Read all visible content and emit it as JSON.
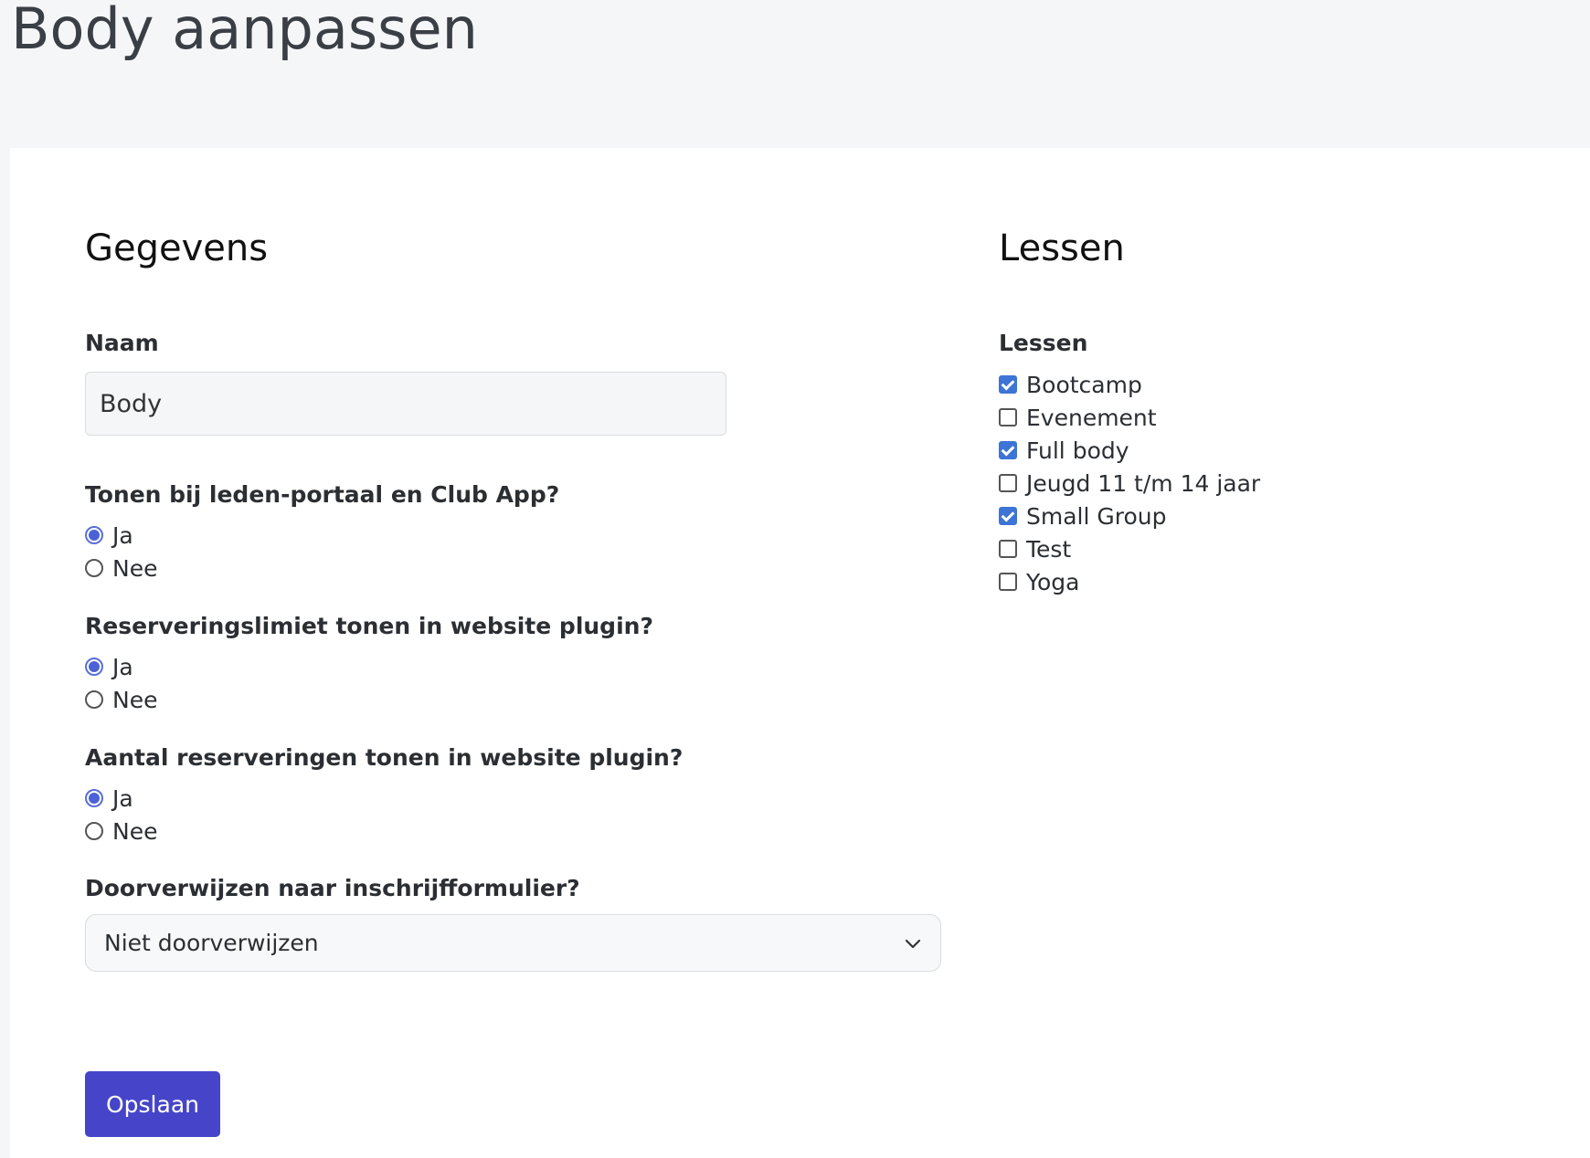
{
  "page": {
    "title": "Body aanpassen"
  },
  "details": {
    "heading": "Gegevens",
    "name_label": "Naam",
    "name_value": "Body",
    "show_portal": {
      "label": "Tonen bij leden-portaal en Club App?",
      "options": [
        "Ja",
        "Nee"
      ],
      "selected": "Ja"
    },
    "show_limit": {
      "label": "Reserveringslimiet tonen in website plugin?",
      "options": [
        "Ja",
        "Nee"
      ],
      "selected": "Ja"
    },
    "show_count": {
      "label": "Aantal reserveringen tonen in website plugin?",
      "options": [
        "Ja",
        "Nee"
      ],
      "selected": "Ja"
    },
    "redirect": {
      "label": "Doorverwijzen naar inschrijfformulier?",
      "selected": "Niet doorverwijzen"
    },
    "save_label": "Opslaan"
  },
  "lessons": {
    "heading": "Lessen",
    "label": "Lessen",
    "items": [
      {
        "label": "Bootcamp",
        "checked": true
      },
      {
        "label": "Evenement",
        "checked": false
      },
      {
        "label": "Full body",
        "checked": true
      },
      {
        "label": "Jeugd 11 t/m 14 jaar",
        "checked": false
      },
      {
        "label": "Small Group",
        "checked": true
      },
      {
        "label": "Test",
        "checked": false
      },
      {
        "label": "Yoga",
        "checked": false
      }
    ]
  },
  "colors": {
    "primary_button": "#4645c9",
    "checkbox_checked": "#3d74d6",
    "radio_checked": "#4a62d6",
    "page_background": "#f5f6f8",
    "card_background": "#ffffff"
  }
}
